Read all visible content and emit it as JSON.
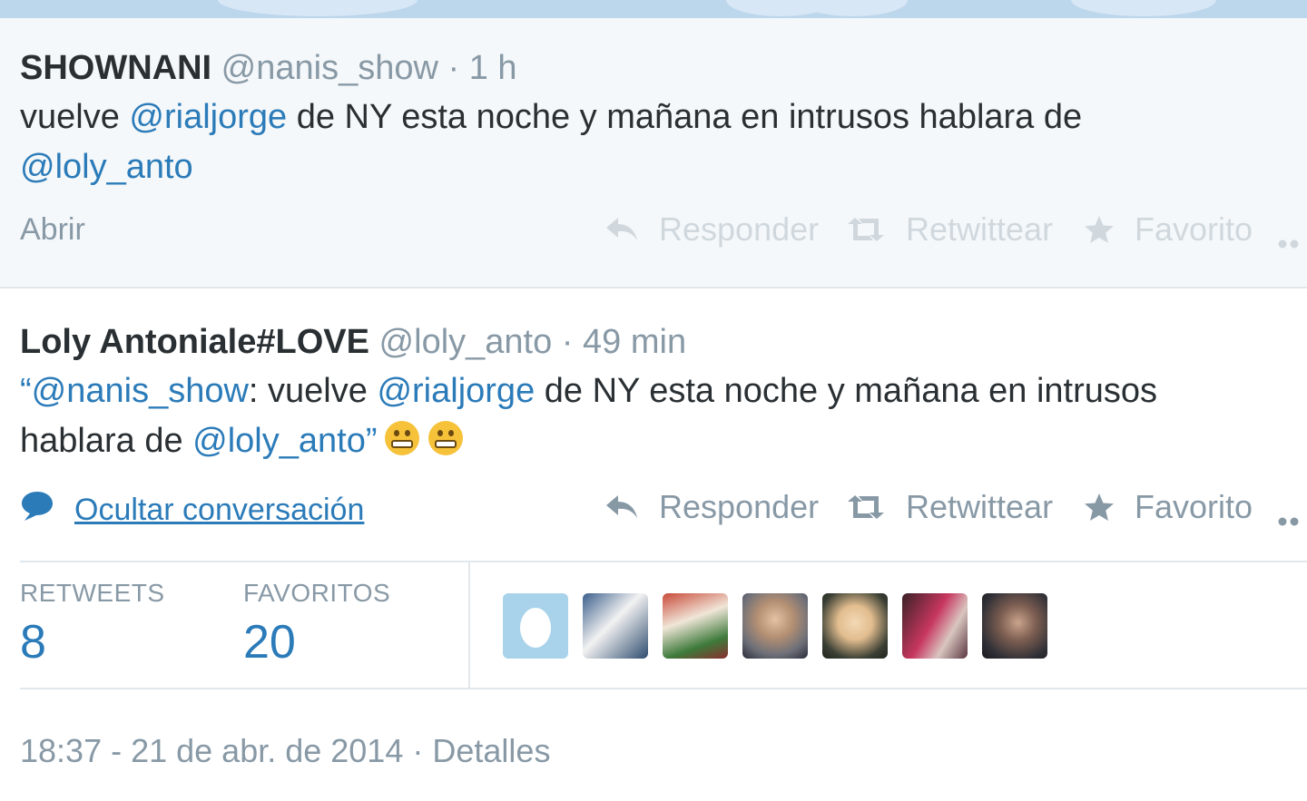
{
  "tweet1": {
    "name": "SHOWNANI",
    "handle": "@nanis_show",
    "separator": "·",
    "time": "1 h",
    "text_1": "vuelve ",
    "mention_1": "@rialjorge",
    "text_2": " de NY  esta noche y mañana en intrusos hablara de",
    "mention_2": "@loly_anto",
    "open_label": "Abrir",
    "reply_label": "Responder",
    "retweet_label": "Retwittear",
    "favorite_label": "Favorito"
  },
  "tweet2": {
    "name": "Loly Antoniale#LOVE",
    "handle": "@loly_anto",
    "separator": "·",
    "time": "49 min",
    "quote_open": "“",
    "mention_1": "@nanis_show",
    "text_1": ": vuelve ",
    "mention_2": "@rialjorge",
    "text_2": " de NY  esta noche y mañana en intrusos",
    "text_3": "hablara de ",
    "mention_3": "@loly_anto",
    "quote_close": "”",
    "emojis": [
      "grimacing-face",
      "grimacing-face"
    ],
    "hide_conversation_label": "Ocultar conversación",
    "reply_label": "Responder",
    "retweet_label": "Retwittear",
    "favorite_label": "Favorito"
  },
  "stats": {
    "retweets_label": "RETWEETS",
    "retweets_count": "8",
    "favorites_label": "FAVORITOS",
    "favorites_count": "20",
    "avatars": [
      "default-egg-avatar",
      "user-avatar",
      "user-avatar",
      "user-avatar",
      "user-avatar",
      "user-avatar",
      "user-avatar"
    ]
  },
  "footer": {
    "timestamp": "18:37 - 21 de abr. de 2014",
    "separator": "·",
    "details_label": "Detalles"
  },
  "colors": {
    "link": "#2b7bb9",
    "muted": "#8899a6",
    "text": "#292f33",
    "faded_action": "#d0d8de",
    "tweet1_background": "#f5f8fa"
  }
}
